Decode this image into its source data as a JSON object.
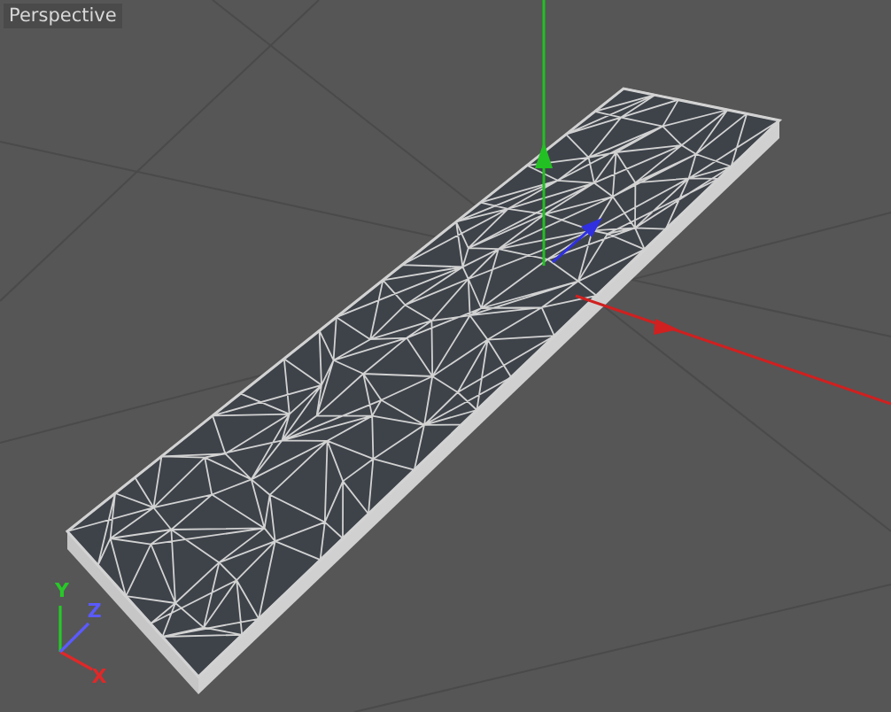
{
  "viewport": {
    "title": "Perspective"
  },
  "gizmo": {
    "axes": [
      {
        "label": "X",
        "color": "#e02828"
      },
      {
        "label": "Y",
        "color": "#28c828"
      },
      {
        "label": "Z",
        "color": "#5a5aff"
      }
    ]
  }
}
